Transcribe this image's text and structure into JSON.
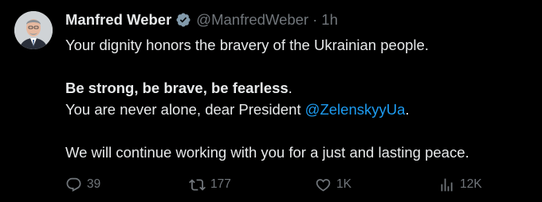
{
  "tweet": {
    "author": {
      "name": "Manfred Weber",
      "handle": "@ManfredWeber",
      "separator": "·",
      "time": "1h",
      "verified_icon": "verified-badge-icon",
      "avatar_icon": "avatar-photo"
    },
    "text": {
      "line1": "Your dignity honors the bravery of the Ukrainian people.",
      "line3_bold": "Be strong, be brave, be fearless",
      "line3_tail": ".",
      "line4_prefix": "You are never alone, dear President ",
      "line4_mention": "@ZelenskyyUa",
      "line4_suffix": ".",
      "line6": "We will continue working with you for a just and lasting peace."
    },
    "actions": {
      "replies": "39",
      "retweets": "177",
      "likes": "1K",
      "views": "12K"
    }
  },
  "colors": {
    "background": "#000000",
    "text": "#e7e9ea",
    "muted": "#71767b",
    "link": "#1d9bf0",
    "verified": "#829aab"
  }
}
